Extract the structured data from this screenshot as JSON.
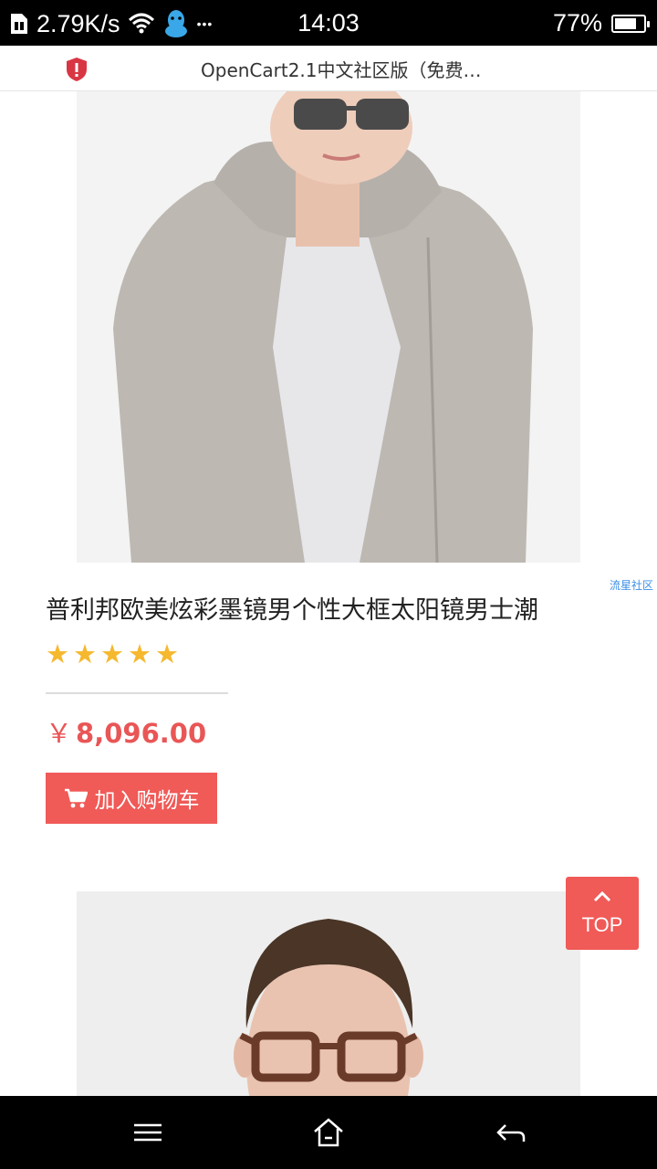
{
  "status_bar": {
    "speed": "2.79K/s",
    "more": "•••",
    "time": "14:03",
    "battery": "77%",
    "battery_level": 0.77
  },
  "browser": {
    "page_title": "OpenCart2.1中文社区版（免费…",
    "security_icon": "shield-alert-icon"
  },
  "side_link": "流星社区",
  "product": {
    "title": "普利邦欧美炫彩墨镜男个性大框太阳镜男士潮",
    "rating": 5,
    "rating_max": 5,
    "currency": "￥",
    "price": "8,096.00",
    "add_to_cart": "加入购物车",
    "cart_icon": "shopping-cart-icon"
  },
  "top_button": {
    "label": "TOP",
    "icon": "chevron-up-icon"
  },
  "nav": {
    "menu_icon": "menu-icon",
    "home_icon": "home-icon",
    "back_icon": "back-icon"
  },
  "colors": {
    "accent": "#f05a57",
    "price": "#e95656",
    "star": "#f5b82e",
    "link": "#3a8ee6"
  }
}
